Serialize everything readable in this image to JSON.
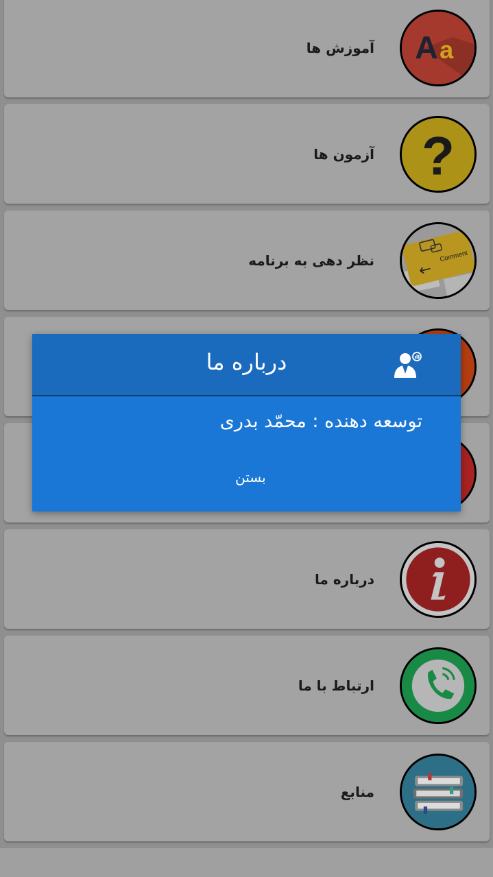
{
  "menu": {
    "items": [
      {
        "label": "آموزش ها",
        "icon": "alphabet-aa-icon",
        "color": "#a5392e"
      },
      {
        "label": "آزمون ها",
        "icon": "question-mark-icon",
        "color": "#ad9218"
      },
      {
        "label": "نظر دهی به برنامه",
        "icon": "comment-keyboard-icon",
        "color": "#a88b1f"
      },
      {
        "label": "",
        "icon": "orange-circle-icon",
        "color": "#b33d10"
      },
      {
        "label": "",
        "icon": "red-circle-icon",
        "color": "#a82222"
      },
      {
        "label": "درباره ما",
        "icon": "info-icon",
        "color": "#8f1f1f"
      },
      {
        "label": "ارتباط با ما",
        "icon": "phone-call-icon",
        "color": "#198a46"
      },
      {
        "label": "منابع",
        "icon": "books-icon",
        "color": "#2e6f88"
      }
    ]
  },
  "dialog": {
    "title": "درباره ما",
    "icon": "support-agent-icon",
    "body": "توسعه دهنده : محمّد بدری",
    "close_label": "بستن"
  }
}
